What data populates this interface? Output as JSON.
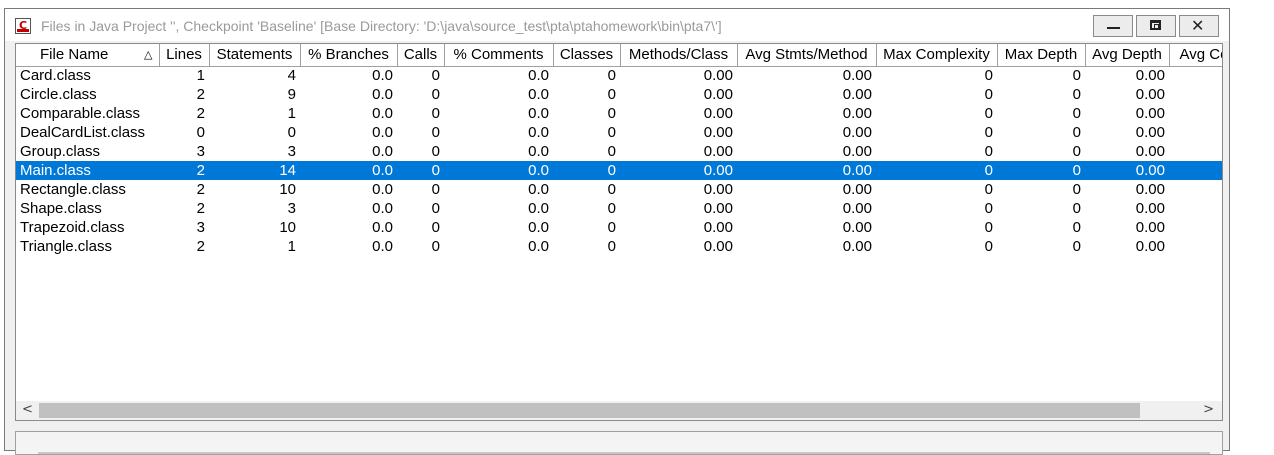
{
  "window": {
    "title": "Files in Java Project '', Checkpoint 'Baseline'  [Base Directory: 'D:\\java\\source_test\\pta\\ptahomework\\bin\\pta7\\']",
    "icon": "app-c-icon"
  },
  "table": {
    "sort_indicator": "△",
    "columns": [
      "File Name",
      "Lines",
      "Statements",
      "% Branches",
      "Calls",
      "% Comments",
      "Classes",
      "Methods/Class",
      "Avg Stmts/Method",
      "Max Complexity",
      "Max Depth",
      "Avg Depth",
      "Avg Co"
    ],
    "rows": [
      [
        "Card.class",
        "1",
        "4",
        "0.0",
        "0",
        "0.0",
        "0",
        "0.00",
        "0.00",
        "0",
        "0",
        "0.00"
      ],
      [
        "Circle.class",
        "2",
        "9",
        "0.0",
        "0",
        "0.0",
        "0",
        "0.00",
        "0.00",
        "0",
        "0",
        "0.00"
      ],
      [
        "Comparable.class",
        "2",
        "1",
        "0.0",
        "0",
        "0.0",
        "0",
        "0.00",
        "0.00",
        "0",
        "0",
        "0.00"
      ],
      [
        "DealCardList.class",
        "0",
        "0",
        "0.0",
        "0",
        "0.0",
        "0",
        "0.00",
        "0.00",
        "0",
        "0",
        "0.00"
      ],
      [
        "Group.class",
        "3",
        "3",
        "0.0",
        "0",
        "0.0",
        "0",
        "0.00",
        "0.00",
        "0",
        "0",
        "0.00"
      ],
      [
        "Main.class",
        "2",
        "14",
        "0.0",
        "0",
        "0.0",
        "0",
        "0.00",
        "0.00",
        "0",
        "0",
        "0.00"
      ],
      [
        "Rectangle.class",
        "2",
        "10",
        "0.0",
        "0",
        "0.0",
        "0",
        "0.00",
        "0.00",
        "0",
        "0",
        "0.00"
      ],
      [
        "Shape.class",
        "2",
        "3",
        "0.0",
        "0",
        "0.0",
        "0",
        "0.00",
        "0.00",
        "0",
        "0",
        "0.00"
      ],
      [
        "Trapezoid.class",
        "3",
        "10",
        "0.0",
        "0",
        "0.0",
        "0",
        "0.00",
        "0.00",
        "0",
        "0",
        "0.00"
      ],
      [
        "Triangle.class",
        "2",
        "1",
        "0.0",
        "0",
        "0.0",
        "0",
        "0.00",
        "0.00",
        "0",
        "0",
        "0.00"
      ]
    ],
    "selected_row": 5
  },
  "colors": {
    "selection": "#0078d7",
    "selection_text": "#ffffff",
    "title_text": "#9a9a9a"
  }
}
